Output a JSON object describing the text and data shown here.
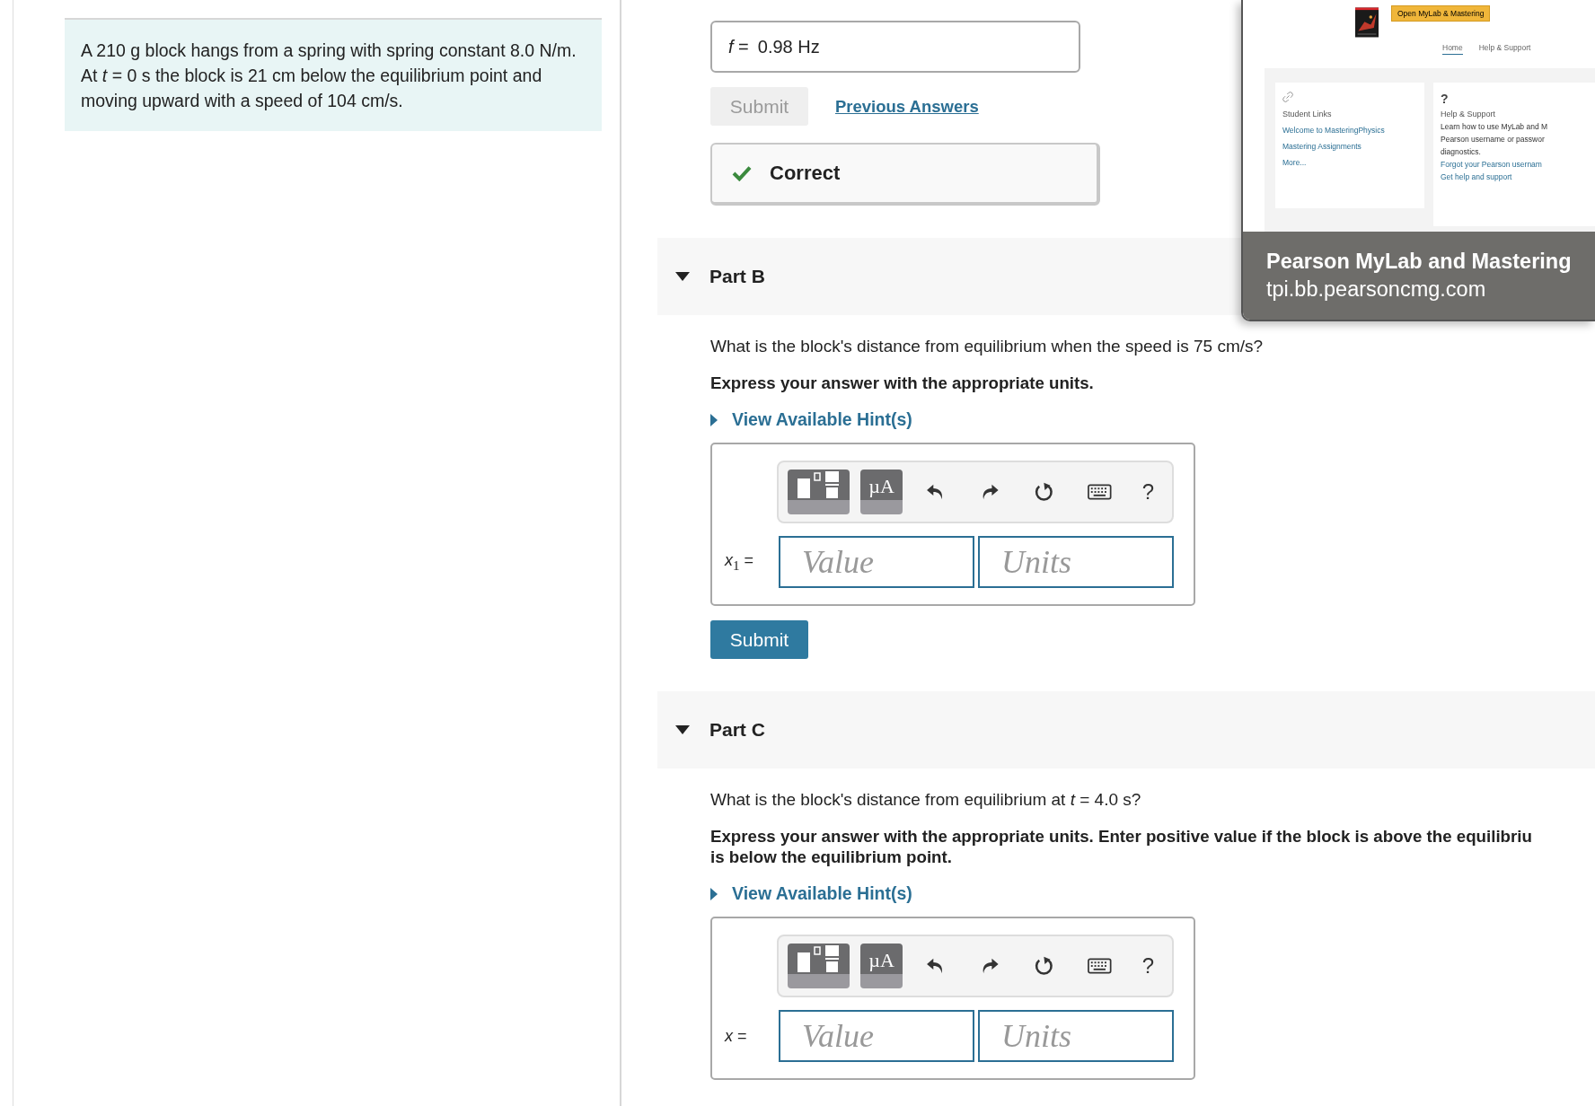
{
  "problem": {
    "statement": "A 210 g block hangs from a spring with spring constant 8.0 N/m. At *t* = 0 s the block is 21 cm below the equilibrium point and moving upward with a speed of 104 cm/s."
  },
  "part_a": {
    "answer_label": "*f* =",
    "answer_value": "0.98 Hz",
    "submit": {
      "label": "Submit",
      "disabled": true
    },
    "previous_answers": "Previous Answers",
    "feedback": {
      "kind": "correct",
      "text": "Correct"
    }
  },
  "parts": [
    {
      "title": "Part B",
      "expanded": true,
      "question": "What is the block's distance from equilibrium when the speed is 75 cm/s?",
      "instructions": [
        "Express your answer with the appropriate units."
      ],
      "hint": "View Available Hint(s)",
      "toolbar_label": "µA",
      "help": "?",
      "answer_label": "*x*$_{1}$ =",
      "value_placeholder": "Value",
      "units_placeholder": "Units",
      "submit": {
        "label": "Submit",
        "disabled": false
      }
    },
    {
      "title": "Part C",
      "expanded": true,
      "question": "What is the block's distance from equilibrium at *t* = 4.0 s?",
      "instructions": [
        "Express your answer with the appropriate units. Enter positive value if the block is above the equilibriu",
        "is below the equilibrium point."
      ],
      "hint": "View Available Hint(s)",
      "toolbar_label": "µA",
      "help": "?",
      "answer_label": "*x* =",
      "value_placeholder": "Value",
      "units_placeholder": "Units"
    }
  ],
  "preview": {
    "open_button": "Open MyLab & Mastering",
    "nav": [
      {
        "label": "Home",
        "selected": true
      },
      {
        "label": "Help & Support",
        "selected": false
      }
    ],
    "student_card": {
      "title": "Student Links",
      "links": [
        "Welcome to MasteringPhysics",
        "Mastering Assignments",
        "More..."
      ]
    },
    "help_card": {
      "icon": "?",
      "title": "Help & Support",
      "text": [
        "Learn how to use MyLab and M",
        "Pearson username or passwor",
        "diagnostics."
      ],
      "links": [
        "Forgot your Pearson usernam",
        "Get help and support"
      ]
    },
    "title": "Pearson MyLab and Mastering",
    "url": "tpi.bb.pearsoncmg.com"
  }
}
